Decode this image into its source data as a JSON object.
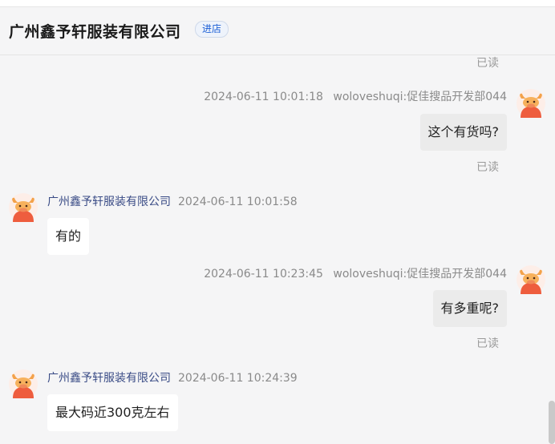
{
  "header": {
    "shop_name": "广州鑫予轩服装有限公司",
    "enter_label": "进店"
  },
  "chat": {
    "top_read": "已读",
    "messages": [
      {
        "time": "2024-06-11 10:01:18",
        "sender": "woloveshuqi:促佳搜品开发部044",
        "text": "这个有货吗?",
        "read": "已读"
      },
      {
        "time": "2024-06-11 10:01:58",
        "sender": "广州鑫予轩服装有限公司",
        "text": "有的"
      },
      {
        "time": "2024-06-11 10:23:45",
        "sender": "woloveshuqi:促佳搜品开发部044",
        "text": "有多重呢?",
        "read": "已读"
      },
      {
        "time": "2024-06-11 10:24:39",
        "sender": "广州鑫予轩服装有限公司",
        "text": "最大码近300克左右"
      }
    ]
  },
  "avatar_icon": "orange-bull-avatar-icon"
}
